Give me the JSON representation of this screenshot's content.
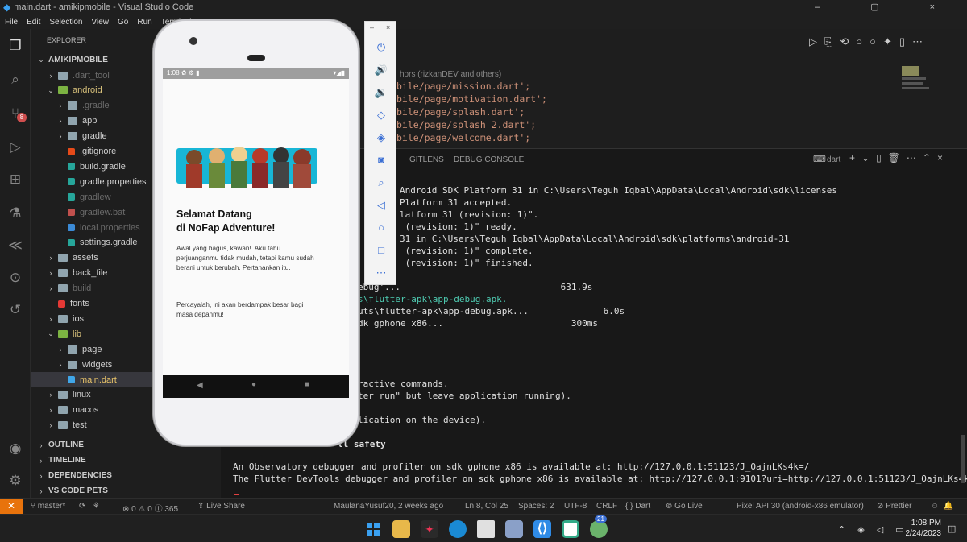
{
  "window": {
    "title": "main.dart - amikipmobile - Visual Studio Code",
    "controls": "– ▢ ×"
  },
  "menu": [
    "File",
    "Edit",
    "Selection",
    "View",
    "Go",
    "Run",
    "Terminal",
    "Help"
  ],
  "activity_bar": {
    "scm_badge": "8"
  },
  "explorer": {
    "header": "EXPLORER",
    "root": "AMIKIPMOBILE",
    "items": [
      {
        "label": ".dart_tool",
        "type": "folder",
        "dim": true
      },
      {
        "label": "android",
        "type": "folder-open"
      },
      {
        "label": ".gradle",
        "type": "folder",
        "dim": true
      },
      {
        "label": "app",
        "type": "folder"
      },
      {
        "label": "gradle",
        "type": "folder"
      },
      {
        "label": ".gitignore",
        "type": "git"
      },
      {
        "label": "build.gradle",
        "type": "gradle"
      },
      {
        "label": "gradle.properties",
        "type": "gradle"
      },
      {
        "label": "gradlew",
        "type": "gradle",
        "dim": true
      },
      {
        "label": "gradlew.bat",
        "type": "bat",
        "dim": true
      },
      {
        "label": "local.properties",
        "type": "gear",
        "dim": true
      },
      {
        "label": "settings.gradle",
        "type": "gradle"
      },
      {
        "label": "assets",
        "type": "folder"
      },
      {
        "label": "back_file",
        "type": "folder"
      },
      {
        "label": "build",
        "type": "folder",
        "dim": true
      },
      {
        "label": "fonts",
        "type": "font"
      },
      {
        "label": "ios",
        "type": "folder"
      },
      {
        "label": "lib",
        "type": "folder-open"
      },
      {
        "label": "page",
        "type": "folder"
      },
      {
        "label": "widgets",
        "type": "folder"
      },
      {
        "label": "main.dart",
        "type": "dart",
        "selected": true
      },
      {
        "label": "linux",
        "type": "folder"
      },
      {
        "label": "macos",
        "type": "folder"
      },
      {
        "label": "test",
        "type": "folder"
      }
    ],
    "sections": [
      "OUTLINE",
      "TIMELINE",
      "DEPENDENCIES",
      "VS CODE PETS"
    ]
  },
  "editor": {
    "blame": "hors (rizkanDEV and others)",
    "lines": [
      "bile/page/mission.dart';",
      "bile/page/motivation.dart';",
      "bile/page/splash.dart';",
      "bile/page/splash_2.dart';",
      "bile/page/welcome.dart';"
    ]
  },
  "panel": {
    "tabs": [
      "GITLENS",
      "DEBUG CONSOLE"
    ],
    "terminal_name": "dart",
    "lines": [
      "Android SDK Platform 31 in C:\\Users\\Teguh Iqbal\\AppData\\Local\\Android\\sdk\\licenses",
      "Platform 31 accepted.",
      "latform 31 (revision: 1)\".",
      " (revision: 1)\" ready.",
      "31 in C:\\Users\\Teguh Iqbal\\AppData\\Local\\Android\\sdk\\platforms\\android-31",
      " (revision: 1)\" complete.",
      " (revision: 1)\" finished.",
      "ebug'...                              631.9s",
      "s\\flutter-apk\\app-debug.apk.",
      "uts\\flutter-apk\\app-debug.apk...              6.0s",
      "dk gphone x86...                        300ms",
      "ractive commands.",
      "ter run\" but leave application running).",
      "lication on the device).",
      "ll safety",
      "An Observatory debugger and profiler on sdk gphone x86 is available at: http://127.0.0.1:51123/J_OajnLKs4k=/",
      "The Flutter DevTools debugger and profiler on sdk gphone x86 is available at: http://127.0.0.1:9101?uri=http://127.0.0.1:51123/J_OajnLKs4k=/"
    ]
  },
  "status": {
    "branch": "master*",
    "problems": "⊗ 0 ⚠ 0 ⓘ 365",
    "live_share": "Live Share",
    "blame": "MaulanaYusuf20, 2 weeks ago",
    "position": "Ln 8, Col 25",
    "spaces": "Spaces: 2",
    "encoding": "UTF-8",
    "eol": "CRLF",
    "language": "{ } Dart",
    "go_live": "Go Live",
    "device": "Pixel API 30 (android-x86 emulator)",
    "prettier": "Prettier"
  },
  "taskbar": {
    "time": "1:08 PM",
    "date": "2/24/2023",
    "badge": "21"
  },
  "phone": {
    "status_time": "1:08",
    "title_line1": "Selamat Datang",
    "title_line2": "di NoFap Adventure!",
    "para1": "Awal yang bagus, kawan!. Aku tahu perjuanganmu tidak mudah, tetapi kamu sudah berani untuk berubah. Pertahankan itu.",
    "para2": "Percayalah, ini akan berdampak besar bagi masa depanmu!"
  },
  "colors": {
    "accent_orange": "#e8730c",
    "folder": "#90a4ae",
    "dart_blue": "#40a6e8",
    "emulator_blue": "#3b6fd4"
  }
}
